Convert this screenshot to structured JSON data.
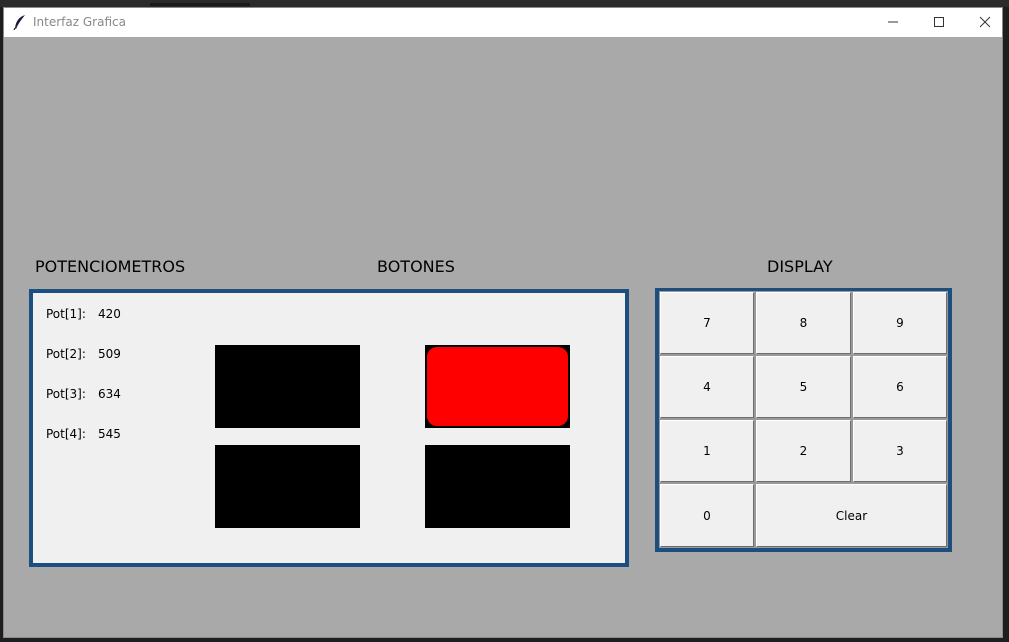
{
  "window": {
    "title": "Interfaz Grafica"
  },
  "sections": {
    "potenciometros": "POTENCIOMETROS",
    "botones": "BOTONES",
    "display": "DISPLAY"
  },
  "potentiometers": [
    {
      "label": "Pot[1]:",
      "value": "420"
    },
    {
      "label": "Pot[2]:",
      "value": "509"
    },
    {
      "label": "Pot[3]:",
      "value": "634"
    },
    {
      "label": "Pot[4]:",
      "value": "545"
    }
  ],
  "buttons": [
    {
      "name": "boton-1",
      "active": false,
      "color": "#000000"
    },
    {
      "name": "boton-2",
      "active": true,
      "color": "#ff0000"
    },
    {
      "name": "boton-3",
      "active": false,
      "color": "#000000"
    },
    {
      "name": "boton-4",
      "active": false,
      "color": "#000000"
    }
  ],
  "keypad": {
    "keys": [
      "7",
      "8",
      "9",
      "4",
      "5",
      "6",
      "1",
      "2",
      "3",
      "0",
      "Clear"
    ]
  },
  "colors": {
    "background": "#a9a9a9",
    "panel": "#f0f0f0",
    "panel_border": "#1d4e80",
    "led_off": "#000000",
    "led_on": "#ff0000"
  }
}
